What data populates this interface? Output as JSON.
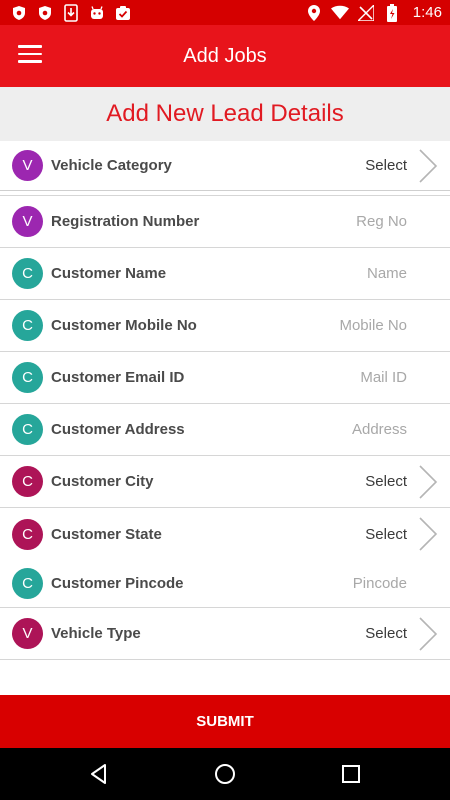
{
  "status_bar": {
    "time": "1:46",
    "left_icons": [
      "shield-icon",
      "shield-icon",
      "download-icon",
      "android-icon",
      "clipboard-check-icon"
    ],
    "right_icons": [
      "location-icon",
      "wifi-icon",
      "no-signal-icon",
      "battery-charging-icon"
    ]
  },
  "app_bar": {
    "title": "Add Jobs",
    "menu_icon": "hamburger-menu-icon"
  },
  "section": {
    "title": "Add New Lead Details"
  },
  "colors": {
    "status_bar": "#d50000",
    "app_bar": "#e8141b",
    "accent_text": "#e11a22",
    "avatar_purple": "#9c27b0",
    "avatar_teal": "#26a69a",
    "avatar_maroon": "#ad1457",
    "submit": "#d80000"
  },
  "fields": [
    {
      "letter": "V",
      "label": "Vehicle Category",
      "value": "Select",
      "kind": "select",
      "avatar_color": "#9c27b0"
    },
    {
      "letter": "V",
      "label": "Registration Number",
      "placeholder": "Reg No",
      "kind": "input",
      "avatar_color": "#9c27b0"
    },
    {
      "letter": "C",
      "label": "Customer Name",
      "placeholder": "Name",
      "kind": "input",
      "avatar_color": "#26a69a"
    },
    {
      "letter": "C",
      "label": "Customer Mobile No",
      "placeholder": "Mobile No",
      "kind": "input",
      "avatar_color": "#26a69a"
    },
    {
      "letter": "C",
      "label": "Customer Email ID",
      "placeholder": "Mail ID",
      "kind": "input",
      "avatar_color": "#26a69a"
    },
    {
      "letter": "C",
      "label": "Customer Address",
      "placeholder": "Address",
      "kind": "input",
      "avatar_color": "#26a69a"
    },
    {
      "letter": "C",
      "label": "Customer City",
      "value": "Select",
      "kind": "select",
      "avatar_color": "#ad1457"
    },
    {
      "letter": "C",
      "label": "Customer State",
      "value": "Select",
      "kind": "select",
      "avatar_color": "#ad1457"
    },
    {
      "letter": "C",
      "label": "Customer Pincode",
      "placeholder": "Pincode",
      "kind": "input",
      "avatar_color": "#26a69a"
    },
    {
      "letter": "V",
      "label": "Vehicle Type",
      "value": "Select",
      "kind": "select",
      "avatar_color": "#ad1457"
    }
  ],
  "submit": {
    "label": "SUBMIT"
  },
  "nav_bar": {
    "icons": [
      "back-icon",
      "home-icon",
      "recents-icon"
    ]
  }
}
